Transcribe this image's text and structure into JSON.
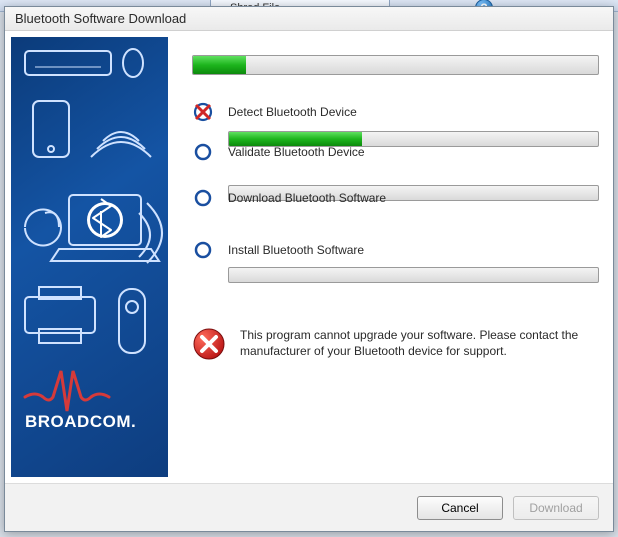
{
  "background": {
    "toolbar_hint": "Shred File",
    "help_glyph": "?"
  },
  "window": {
    "title": "Bluetooth Software Download"
  },
  "progress": {
    "overall_percent": 13
  },
  "steps": [
    {
      "id": "detect",
      "icon": "failed",
      "label": "Detect Bluetooth Device",
      "percent": 0
    },
    {
      "id": "validate",
      "icon": "pending",
      "label": "Validate Bluetooth Device",
      "percent": 36
    },
    {
      "id": "download",
      "icon": "pending",
      "label": "Download Bluetooth Software",
      "percent": 0
    },
    {
      "id": "install",
      "icon": "pending",
      "label": "Install Bluetooth Software",
      "percent": 0
    }
  ],
  "error": {
    "message": "This program cannot upgrade your software. Please contact the manufacturer of your Bluetooth device for support."
  },
  "buttons": {
    "cancel": "Cancel",
    "download": "Download",
    "download_enabled": false
  },
  "branding": {
    "vendor": "BROADCOM."
  }
}
